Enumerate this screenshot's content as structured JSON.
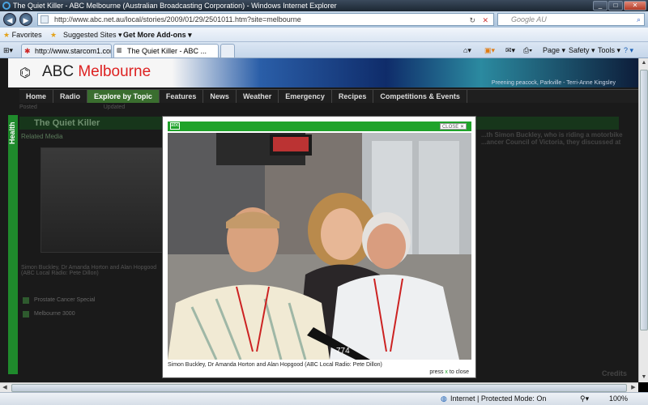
{
  "window": {
    "title": "The Quiet Killer - ABC Melbourne (Australian Broadcasting Corporation) - Windows Internet Explorer",
    "minimize": "_",
    "maximize": "□",
    "close": "✕"
  },
  "address_bar": {
    "url": "http://www.abc.net.au/local/stories/2009/01/29/2501011.htm?site=melbourne",
    "search_placeholder": "Google AU",
    "back": "◀",
    "forward": "▶",
    "refresh": "↻",
    "stop": "✕"
  },
  "favorites_bar": {
    "favorites": "Favorites",
    "suggested": "Suggested Sites ▾",
    "addons": "Get More Add-ons ▾"
  },
  "tabs": [
    {
      "label": "http://www.starcom1.com..."
    },
    {
      "label": "The Quiet Killer - ABC ..."
    }
  ],
  "command_bar": {
    "page": "Page ▾",
    "safety": "Safety ▾",
    "tools": "Tools ▾",
    "help": "? ▾"
  },
  "site": {
    "brand": "ABC",
    "station": "Melbourne",
    "banner_caption": "Preening peacock, Parkville - Terri-Anne Kingsley",
    "nav": [
      "Home",
      "Radio",
      "Explore by Topic",
      "Features",
      "News",
      "Weather",
      "Emergency",
      "Recipes",
      "Competitions & Events"
    ],
    "subbar_posted": "Posted",
    "subbar_updated": "Updated",
    "side_tab": "Health",
    "article_title": "The Quiet Killer",
    "related_title": "Related Media",
    "thumb_caption": "Simon Buckley, Dr Amanda Horton and Alan Hopgood (ABC Local Radio: Pete Dillon)",
    "related_items": [
      "Prostate Cancer Special",
      "Melbourne 3000"
    ],
    "right_text": "...th Simon Buckley, who is riding a motorbike ...ancer Council of Victoria, they discussed at",
    "credits": "Credits"
  },
  "lightbox": {
    "logo": "abc",
    "close_label": "CLOSE ✕",
    "caption": "Simon Buckley, Dr Amanda Horton and Alan Hopgood (ABC Local Radio: Pete Dillon)",
    "press_prefix": "press",
    "press_key": "x",
    "press_suffix": "to close",
    "mic_label": "774"
  },
  "status_bar": {
    "zone": "Internet | Protected Mode: On",
    "zoom": "100%"
  },
  "colors": {
    "abc_green": "#1fa32a",
    "ie_chrome": "#c9d9ea",
    "page_bg": "#1a1a1a"
  }
}
